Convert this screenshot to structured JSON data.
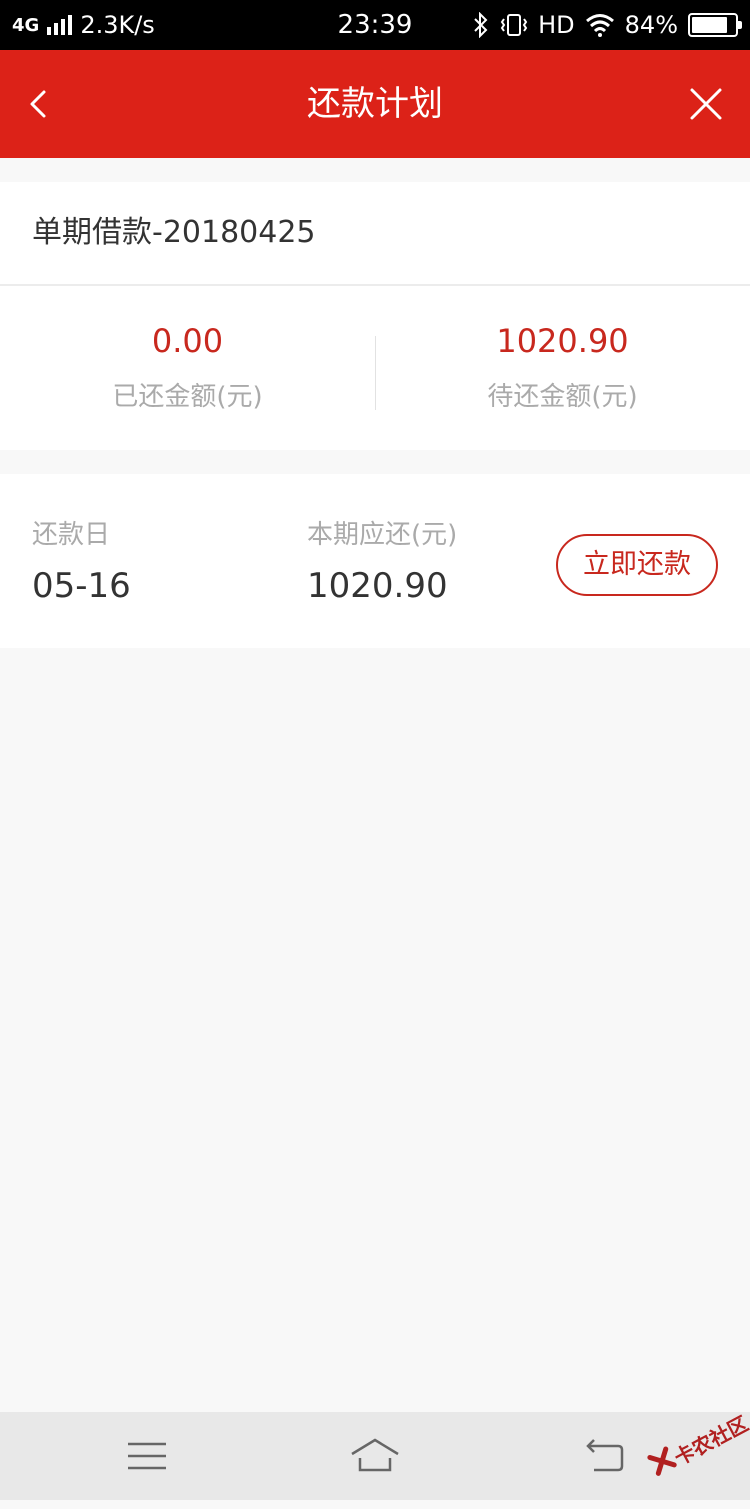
{
  "status_bar": {
    "network": "4G",
    "speed": "2.3K/s",
    "time": "23:39",
    "hd": "HD",
    "battery": "84%",
    "battery_level": 0.84
  },
  "header": {
    "title": "还款计划"
  },
  "loan": {
    "title": "单期借款-20180425"
  },
  "summary": {
    "paid_value": "0.00",
    "paid_label": "已还金额(元)",
    "pending_value": "1020.90",
    "pending_label": "待还金额(元)"
  },
  "installment": {
    "due_label": "还款日",
    "due_value": "05-16",
    "amount_label": "本期应还(元)",
    "amount_value": "1020.90",
    "pay_button": "立即还款"
  },
  "watermark": {
    "text": "卡农社区"
  },
  "colors": {
    "header_red": "#dc2218",
    "accent_red": "#c8281e"
  }
}
